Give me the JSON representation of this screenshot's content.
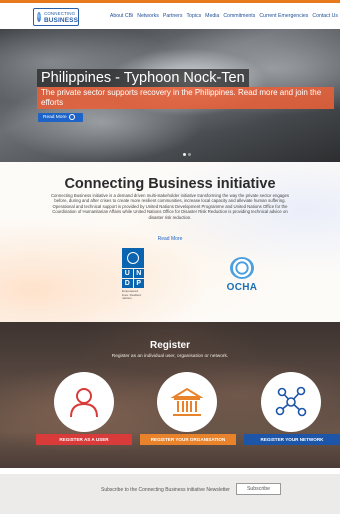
{
  "header": {
    "logo": {
      "line1": "CONNECTING",
      "line2": "BUSINESS"
    },
    "nav": [
      "About CBi",
      "Networks",
      "Partners",
      "Topics",
      "Media",
      "Commitments",
      "Current Emergencies",
      "Contact Us"
    ]
  },
  "hero": {
    "title": "Philippines - Typhoon Nock-Ten",
    "subtitle": "The private sector supports recovery in the Philippines. Read more and join the efforts",
    "button": "Read More"
  },
  "intro": {
    "title": "Connecting Business initiative",
    "body": "Connecting Business initiative is a demand driven multi-stakeholder initiative transforming the way the private sector engages before, during and after crises to create more resilient communities, increase local capacity and alleviate human suffering. Operational and technical support is provided by United Nations Development Programme and United Nations Office for the Coordination of Humanitarian Affairs while United Nations Office for Disaster Risk Reduction is providing technical advice on disaster risk reduction.",
    "read_more": "Read More",
    "undp_letters": [
      "U",
      "N",
      "D",
      "P"
    ],
    "undp_caption": "Empowered lives. Resilient nations.",
    "ocha": "OCHA"
  },
  "register": {
    "title": "Register",
    "subtitle": "Register as an individual user, organisation or network.",
    "user_button": "REGISTER AS A USER",
    "org_button": "REGISTER YOUR ORGANISATION",
    "network_button": "REGISTER YOUR NETWORK",
    "colors": {
      "user": "#d93a3a",
      "org": "#e8822b",
      "network": "#1d55a8"
    }
  },
  "footer": {
    "text": "Subscribe to the Connecting Business initiative Newsletter",
    "button": "Subscribe"
  }
}
